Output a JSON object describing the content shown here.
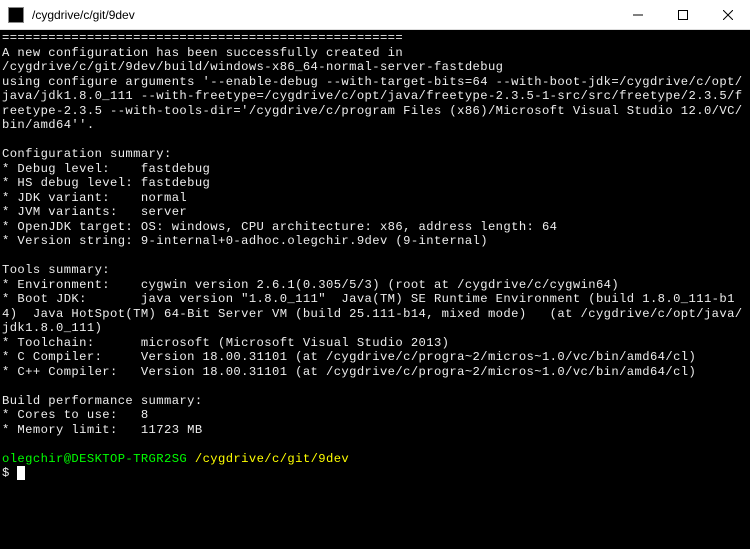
{
  "window": {
    "title": "/cygdrive/c/git/9dev"
  },
  "terminal": {
    "separator": "====================================================",
    "created_msg": "A new configuration has been successfully created in",
    "build_path": "/cygdrive/c/git/9dev/build/windows-x86_64-normal-server-fastdebug",
    "configure_args": "using configure arguments '--enable-debug --with-target-bits=64 --with-boot-jdk=/cygdrive/c/opt/java/jdk1.8.0_111 --with-freetype=/cygdrive/c/opt/java/freetype-2.3.5-1-src/src/freetype/2.3.5/freetype-2.3.5 --with-tools-dir='/cygdrive/c/program Files (x86)/Microsoft Visual Studio 12.0/VC/bin/amd64''.",
    "config_summary_header": "Configuration summary:",
    "debug_level": "* Debug level:    fastdebug",
    "hs_debug": "* HS debug level: fastdebug",
    "jdk_variant": "* JDK variant:    normal",
    "jvm_variants": "* JVM variants:   server",
    "openjdk_target": "* OpenJDK target: OS: windows, CPU architecture: x86, address length: 64",
    "version_string": "* Version string: 9-internal+0-adhoc.olegchir.9dev (9-internal)",
    "tools_header": "Tools summary:",
    "environment": "* Environment:    cygwin version 2.6.1(0.305/5/3) (root at /cygdrive/c/cygwin64)",
    "boot_jdk": "* Boot JDK:       java version \"1.8.0_111\"  Java(TM) SE Runtime Environment (build 1.8.0_111-b14)  Java HotSpot(TM) 64-Bit Server VM (build 25.111-b14, mixed mode)   (at /cygdrive/c/opt/java/jdk1.8.0_111)",
    "toolchain": "* Toolchain:      microsoft (Microsoft Visual Studio 2013)",
    "c_compiler": "* C Compiler:     Version 18.00.31101 (at /cygdrive/c/progra~2/micros~1.0/vc/bin/amd64/cl)",
    "cpp_compiler": "* C++ Compiler:   Version 18.00.31101 (at /cygdrive/c/progra~2/micros~1.0/vc/bin/amd64/cl)",
    "build_perf_header": "Build performance summary:",
    "cores": "* Cores to use:   8",
    "memory": "* Memory limit:   11723 MB",
    "prompt_user": "olegchir@DESKTOP-TRGR2SG",
    "prompt_path": "/cygdrive/c/git/9dev",
    "prompt_char": "$"
  }
}
